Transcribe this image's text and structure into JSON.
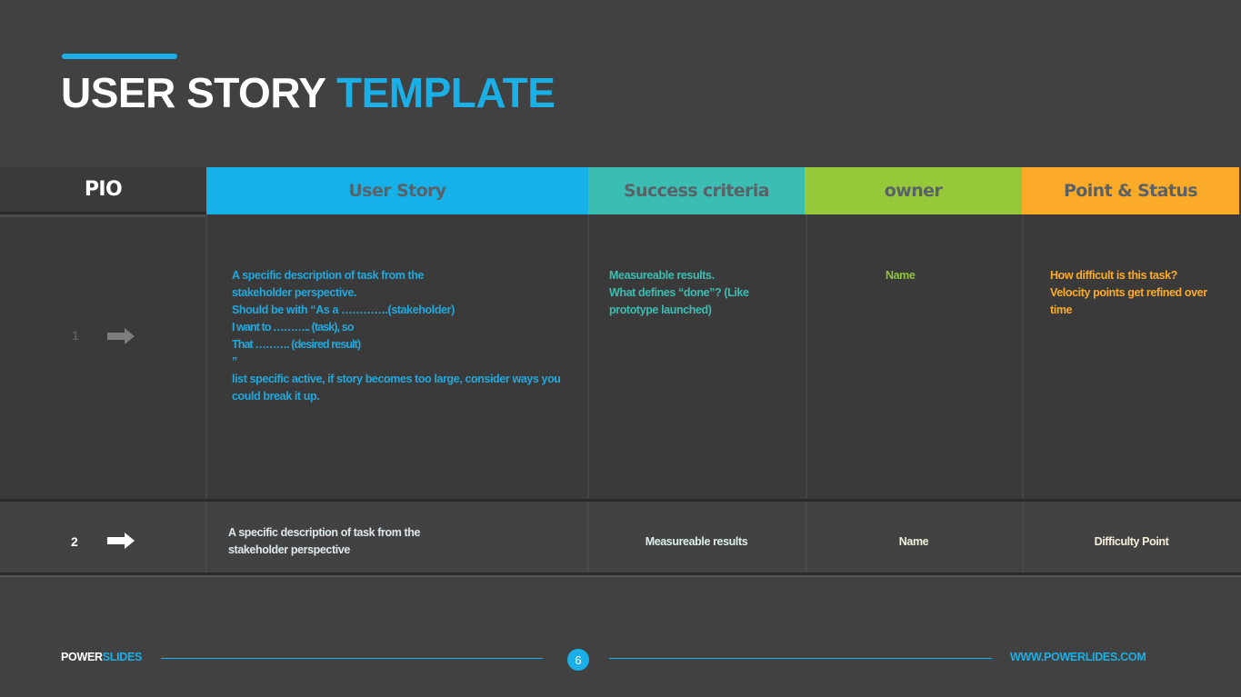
{
  "title": {
    "part1": "USER STORY",
    "part2": "TEMPLATE"
  },
  "colors": {
    "accent": "#1aafe6",
    "user_story": "#16b1e8",
    "success_criteria": "#3cbdb2",
    "owner": "#96c93a",
    "point_status": "#fcab28",
    "background": "#414141"
  },
  "table": {
    "headers": [
      "PIO",
      "User Story",
      "Success  criteria",
      "owner",
      "Point & Status"
    ],
    "rows": [
      {
        "number": "1",
        "icon": "arrow-right-icon",
        "user_story": [
          "A specific description of task from the",
          "stakeholder perspective.",
          "Should be with “As a ………….(stakeholder)",
          "I want to ……….. (task), so",
          "That ………. (desired result)",
          "”",
          "list specific active, if story becomes too large, consider ways you",
          "could break it up."
        ],
        "success_criteria": [
          "Measureable results.",
          "What defines “done”? (Like",
          "prototype launched)"
        ],
        "owner": "Name",
        "point_status": [
          "How difficult is this task?",
          "Velocity points get refined over",
          "time"
        ]
      },
      {
        "number": "2",
        "icon": "arrow-right-icon",
        "user_story": [
          "A specific description of task from the",
          "stakeholder perspective"
        ],
        "success_criteria": "Measureable results",
        "owner": "Name",
        "point_status": "Difficulty Point"
      }
    ]
  },
  "footer": {
    "brand_part1": "POWER",
    "brand_part2": "SLIDES",
    "page_number": "6",
    "url": "WWW.POWERLIDES.COM"
  }
}
